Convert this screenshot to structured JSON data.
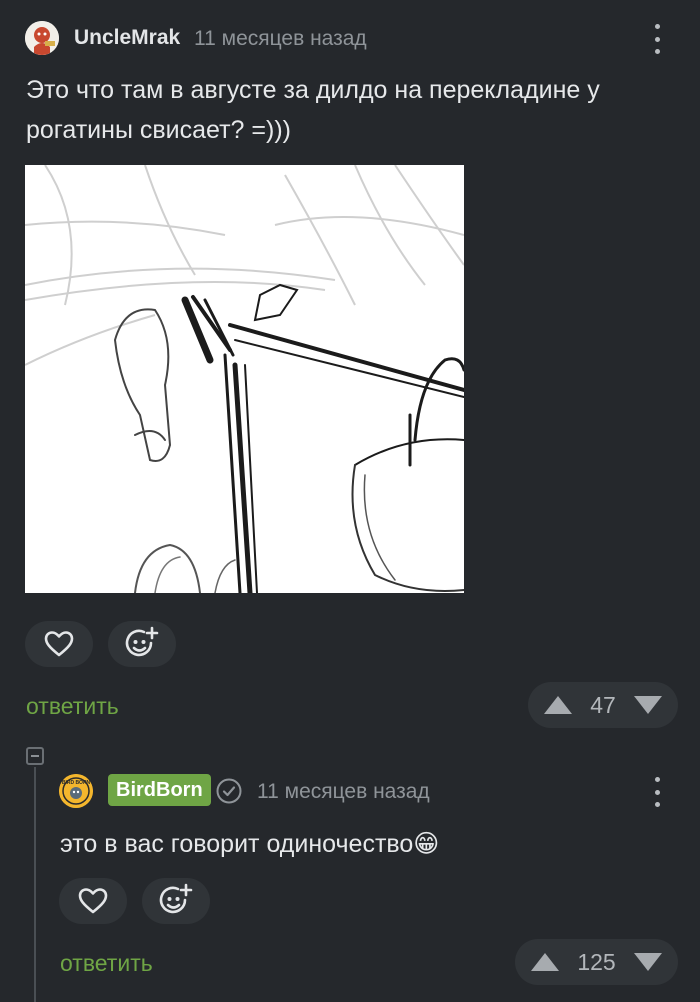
{
  "comment1": {
    "username": "UncleMrak",
    "time": "11 месяцев назад",
    "text": "Это что там в августе за дилдо на перекладине у рогатины свисает? =)))",
    "reply_label": "ответить",
    "rating": "47"
  },
  "comment2": {
    "username": "BirdBorn",
    "avatar_text": "BIRD BORN",
    "time": "11 месяцев назад",
    "text": "это в вас говорит одиночество",
    "emoji": "😁",
    "reply_label": "ответить",
    "rating": "125"
  },
  "colors": {
    "background": "#25282c",
    "accent_green": "#6fa545",
    "button_bg": "#303438"
  },
  "icons": [
    "heart-icon",
    "add-reaction-icon",
    "verified-check-icon",
    "arrow-up-icon",
    "arrow-down-icon",
    "more-vertical-icon",
    "collapse-thread-icon"
  ]
}
